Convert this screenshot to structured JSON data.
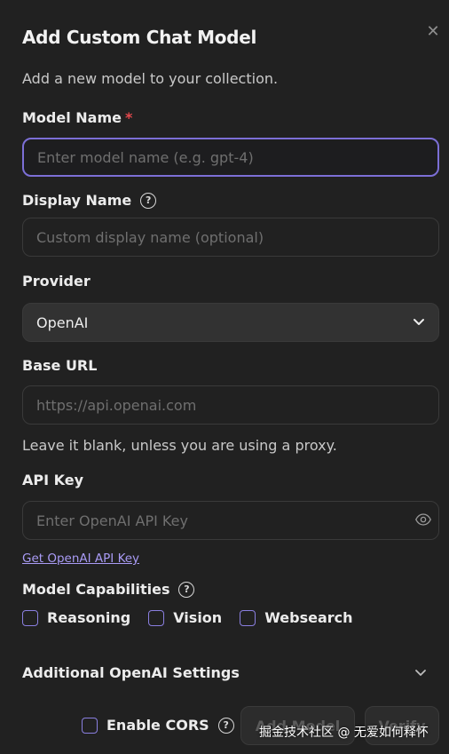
{
  "dialog": {
    "title": "Add Custom Chat Model",
    "close_icon": "close-icon",
    "subtitle": "Add a new model to your collection."
  },
  "model_name": {
    "label": "Model Name",
    "required_mark": "*",
    "placeholder": "Enter model name (e.g. gpt-4)",
    "value": ""
  },
  "display_name": {
    "label": "Display Name",
    "help_icon": "help-circle-icon",
    "help_glyph": "?",
    "placeholder": "Custom display name (optional)",
    "value": ""
  },
  "provider": {
    "label": "Provider",
    "selected": "OpenAI",
    "chevron_icon": "chevron-down-icon"
  },
  "base_url": {
    "label": "Base URL",
    "placeholder": "https://api.openai.com",
    "value": "",
    "hint": "Leave it blank, unless you are using a proxy."
  },
  "api_key": {
    "label": "API Key",
    "placeholder": "Enter OpenAI API Key",
    "value": "",
    "visibility_icon": "eye-icon",
    "link": "Get OpenAI API Key"
  },
  "capabilities": {
    "label": "Model Capabilities",
    "help_glyph": "?",
    "items": [
      {
        "label": "Reasoning",
        "checked": false
      },
      {
        "label": "Vision",
        "checked": false
      },
      {
        "label": "Websearch",
        "checked": false
      }
    ]
  },
  "additional": {
    "label": "Additional OpenAI Settings",
    "chevron_icon": "chevron-down-icon"
  },
  "footer": {
    "cors_label": "Enable CORS",
    "cors_checked": false,
    "help_glyph": "?",
    "add_button": "Add Model",
    "verify_button": "Verify"
  },
  "watermark": "掘金技术社区 @ 无爱如何释怀",
  "colors": {
    "background": "#212121",
    "accent": "#7c6fd6",
    "link": "#a99bf5",
    "required": "#e5484d"
  }
}
